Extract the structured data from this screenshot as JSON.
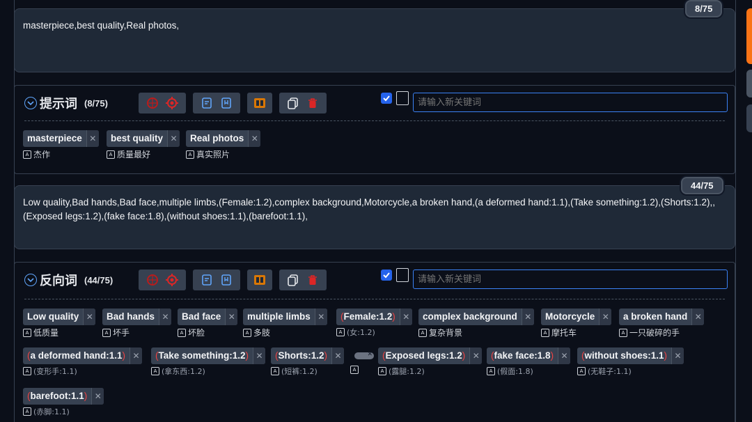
{
  "positive": {
    "prompt_text": "masterpiece,best quality,Real photos,",
    "counter": "8/75",
    "title": "提示词",
    "count": "(8/75)",
    "keyword_placeholder": "请输入新关键词",
    "tags": [
      {
        "text": "masterpiece",
        "translation": "杰作",
        "weight": ""
      },
      {
        "text": "best quality",
        "translation": "质量最好",
        "weight": ""
      },
      {
        "text": "Real photos",
        "translation": "真实照片",
        "weight": ""
      }
    ]
  },
  "negative": {
    "prompt_text": "Low quality,Bad hands,Bad face,multiple limbs,(Female:1.2),complex background,Motorcycle,a broken hand,(a deformed hand:1.1),(Take something:1.2),(Shorts:1.2),,(Exposed legs:1.2),(fake face:1.8),(without shoes:1.1),(barefoot:1.1),",
    "counter": "44/75",
    "title": "反向词",
    "count": "(44/75)",
    "keyword_placeholder": "请输入新关键词",
    "tags": [
      {
        "text": "Low quality",
        "translation": "低质量",
        "weight": ""
      },
      {
        "text": "Bad hands",
        "translation": "坏手",
        "weight": ""
      },
      {
        "text": "Bad face",
        "translation": "坏脸",
        "weight": ""
      },
      {
        "text": "multiple limbs",
        "translation": "多肢",
        "weight": ""
      },
      {
        "text": "Female:1.2",
        "translation": "(女:1.2)",
        "weight": ""
      },
      {
        "text": "complex background",
        "translation": "复杂背景",
        "weight": ""
      },
      {
        "text": "Motorcycle",
        "translation": "摩托车",
        "weight": ""
      },
      {
        "text": "a broken hand",
        "translation": "一只破碎的手",
        "weight": ""
      },
      {
        "text": "a deformed hand:1.1",
        "translation": "(变形手:1.1)",
        "weight": ""
      },
      {
        "text": "Take something:1.2",
        "translation": "(拿东西:1.2)",
        "weight": ""
      },
      {
        "text": "Shorts:1.2",
        "translation": "(短裤:1.2)",
        "weight": ""
      },
      {
        "text": "",
        "translation": "",
        "weight": ""
      },
      {
        "text": "Exposed legs:1.2",
        "translation": "(露腿:1.2)",
        "weight": ""
      },
      {
        "text": "fake face:1.8",
        "translation": "(假面:1.8)",
        "weight": ""
      },
      {
        "text": "without shoes:1.1",
        "translation": "(无鞋子:1.1)",
        "weight": ""
      },
      {
        "text": "barefoot:1.1",
        "translation": "(赤脚:1.1)",
        "weight": ""
      }
    ]
  },
  "icons": {
    "translate": "translate-icon",
    "close": "close-icon"
  },
  "colors": {
    "accent_blue": "#3b82f6",
    "danger_red": "#dc2626",
    "orange": "#d97706",
    "side_tab_orange": "#f97316"
  }
}
